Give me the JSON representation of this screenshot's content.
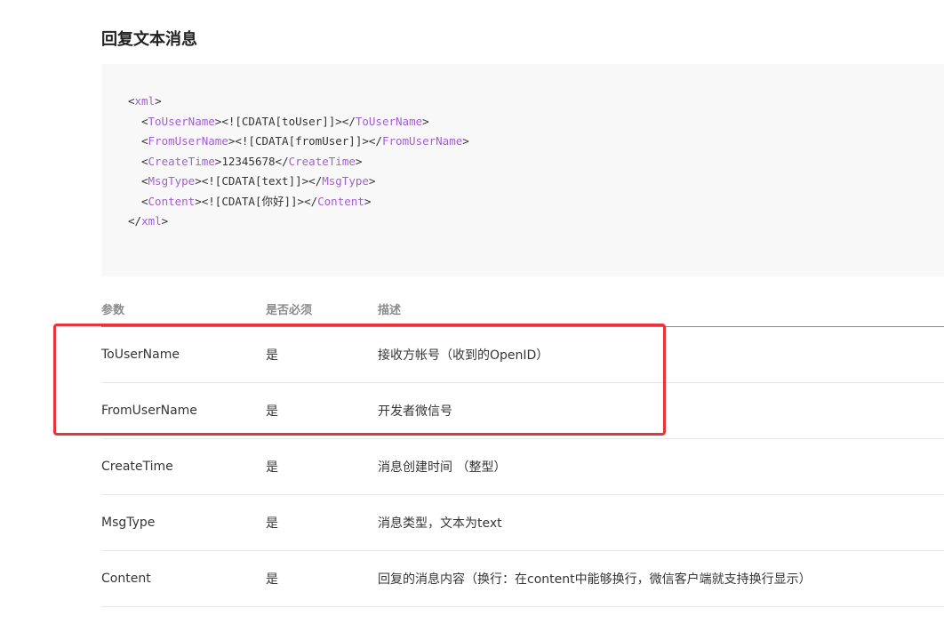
{
  "section": {
    "title": "回复文本消息"
  },
  "code": {
    "root_tag": "xml",
    "fields": [
      {
        "tag": "ToUserName",
        "value": "<![CDATA[toUser]]>"
      },
      {
        "tag": "FromUserName",
        "value": "<![CDATA[fromUser]]>"
      },
      {
        "tag": "CreateTime",
        "value": "12345678"
      },
      {
        "tag": "MsgType",
        "value": "<![CDATA[text]]>"
      },
      {
        "tag": "Content",
        "value": "<![CDATA[你好]]>"
      }
    ]
  },
  "table": {
    "headers": {
      "param": "参数",
      "required": "是否必须",
      "description": "描述"
    },
    "rows": [
      {
        "param": "ToUserName",
        "required": "是",
        "description": "接收方帐号（收到的OpenID）"
      },
      {
        "param": "FromUserName",
        "required": "是",
        "description": "开发者微信号"
      },
      {
        "param": "CreateTime",
        "required": "是",
        "description": "消息创建时间 （整型）"
      },
      {
        "param": "MsgType",
        "required": "是",
        "description": "消息类型，文本为text"
      },
      {
        "param": "Content",
        "required": "是",
        "description": "回复的消息内容（换行：在content中能够换行，微信客户端就支持换行显示）"
      }
    ]
  },
  "colors": {
    "tag": "#a35fd1",
    "highlight": "#e8333b",
    "code_background": "#f8f8f8"
  }
}
